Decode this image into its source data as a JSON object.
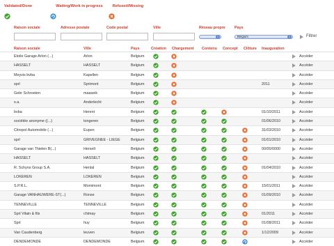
{
  "legend": {
    "done": "Validated/Done",
    "wip": "Waiting/Work in progress",
    "refused": "Refused/Missing"
  },
  "filters": {
    "labels": {
      "raison": "Raison sociale",
      "adresse": "Adresse postale",
      "code": "Code postal",
      "ville": "Ville",
      "reseau": "Réseau propre",
      "pays": "Pays"
    },
    "reseau_value": "",
    "pays_value": "Belgium",
    "filter_button": "Filtrer"
  },
  "table": {
    "headers": {
      "raison": "Raison sociale",
      "ville": "Ville",
      "pays": "Pays",
      "creation": "Création",
      "chargement": "Chargement",
      "contenu": "Contenu",
      "concept": "Concept",
      "cloture": "Clôture",
      "inauguration": "Inauguration"
    },
    "action_label": "Accéder",
    "rows": [
      {
        "raison": "Etoile Garage Arlon (...)",
        "ville": "Arlon",
        "pays": "Belgium",
        "creation": "done",
        "chargement": "refused",
        "contenu": "",
        "concept": "",
        "cloture": "",
        "inauguration": ""
      },
      {
        "raison": "HASSELT",
        "ville": "HASSELT",
        "pays": "Belgium",
        "creation": "done",
        "chargement": "refused",
        "contenu": "",
        "concept": "",
        "cloture": "",
        "inauguration": ""
      },
      {
        "raison": "Meyvis bvba",
        "ville": "Kapellen",
        "pays": "Belgium",
        "creation": "done",
        "chargement": "refused",
        "contenu": "",
        "concept": "",
        "cloture": "",
        "inauguration": ""
      },
      {
        "raison": "sprl",
        "ville": "Sprimont",
        "pays": "Belgium",
        "creation": "done",
        "chargement": "refused",
        "contenu": "",
        "concept": "",
        "cloture": "",
        "inauguration": "2011"
      },
      {
        "raison": "Gebr Schroeten",
        "ville": "maaseik",
        "pays": "Belgium",
        "creation": "done",
        "chargement": "refused",
        "contenu": "",
        "concept": "",
        "cloture": "",
        "inauguration": ""
      },
      {
        "raison": "s.a.",
        "ville": "Anderlecht",
        "pays": "Belgium",
        "creation": "done",
        "chargement": "refused",
        "contenu": "",
        "concept": "",
        "cloture": "",
        "inauguration": ""
      },
      {
        "raison": "bvba",
        "ville": "Herent",
        "pays": "Belgium",
        "creation": "done",
        "chargement": "done",
        "contenu": "done",
        "concept": "refused",
        "cloture": "",
        "inauguration": "01/10/2011"
      },
      {
        "raison": "sociétée anonyme ((...)",
        "ville": "tongeren",
        "pays": "Belgium",
        "creation": "done",
        "chargement": "done",
        "contenu": "done",
        "concept": "done",
        "cloture": "",
        "inauguration": "01/06/2010"
      },
      {
        "raison": "Citropol Automobile (...)",
        "ville": "Eupen",
        "pays": "Belgium",
        "creation": "done",
        "chargement": "done",
        "contenu": "done",
        "concept": "done",
        "cloture": "refused",
        "inauguration": "31/03/2010"
      },
      {
        "raison": "sprl",
        "ville": "GRIVEGNEE - LIEGE",
        "pays": "Belgium",
        "creation": "done",
        "chargement": "done",
        "contenu": "done",
        "concept": "done",
        "cloture": "refused",
        "inauguration": "01/01/2010"
      },
      {
        "raison": "Garage van Thielen B(...)",
        "ville": "Herselt",
        "pays": "Belgium",
        "creation": "done",
        "chargement": "done",
        "contenu": "done",
        "concept": "done",
        "cloture": "refused",
        "inauguration": "00/00/0000"
      },
      {
        "raison": "HASSELT",
        "ville": "HASSELT",
        "pays": "Belgium",
        "creation": "done",
        "chargement": "done",
        "contenu": "done",
        "concept": "done",
        "cloture": "refused",
        "inauguration": ""
      },
      {
        "raison": "R. Schyns Group S.A.",
        "ville": "Henlal",
        "pays": "Belgium",
        "creation": "done",
        "chargement": "done",
        "contenu": "done",
        "concept": "done",
        "cloture": "refused",
        "inauguration": "01/04/2010"
      },
      {
        "raison": "LOKEREN",
        "ville": "LOKEREN",
        "pays": "Belgium",
        "creation": "done",
        "chargement": "done",
        "contenu": "done",
        "concept": "done",
        "cloture": "refused",
        "inauguration": ""
      },
      {
        "raison": "S.P.R.L.",
        "ville": "Momimont",
        "pays": "Belgium",
        "creation": "done",
        "chargement": "done",
        "contenu": "done",
        "concept": "done",
        "cloture": "refused",
        "inauguration": "15/01/2011"
      },
      {
        "raison": "Garage VANHAUWERE-ST(...)",
        "ville": "Ronse",
        "pays": "Belgium",
        "creation": "done",
        "chargement": "done",
        "contenu": "done",
        "concept": "done",
        "cloture": "refused",
        "inauguration": "01/09/2010"
      },
      {
        "raison": "TENNEVILLE",
        "ville": "TENNEVILLE",
        "pays": "Belgium",
        "creation": "done",
        "chargement": "done",
        "contenu": "done",
        "concept": "done",
        "cloture": "refused",
        "inauguration": ""
      },
      {
        "raison": "Sprl Vilain & fils",
        "ville": "chimay",
        "pays": "Belgium",
        "creation": "done",
        "chargement": "done",
        "contenu": "done",
        "concept": "done",
        "cloture": "refused",
        "inauguration": "01/2011"
      },
      {
        "raison": "Sprl",
        "ville": "huy",
        "pays": "Belgium",
        "creation": "done",
        "chargement": "done",
        "contenu": "done",
        "concept": "done",
        "cloture": "refused",
        "inauguration": "01/08/2011"
      },
      {
        "raison": "Van Caudenberg",
        "ville": "leuven",
        "pays": "Belgium",
        "creation": "done",
        "chargement": "done",
        "contenu": "done",
        "concept": "done",
        "cloture": "refused",
        "inauguration": "1/12/2009"
      },
      {
        "raison": "DENDEMONDE",
        "ville": "DENDEMONDE",
        "pays": "Belgium",
        "creation": "done",
        "chargement": "done",
        "contenu": "done",
        "concept": "done",
        "cloture": "wip",
        "inauguration": ""
      }
    ]
  },
  "colors": {
    "accent_red": "#d03a2a",
    "done": "#3fa52a",
    "wip": "#3b8fd8",
    "refused": "#e8692c"
  },
  "icons": {
    "done": "check-circle-icon",
    "wip": "refresh-circle-icon",
    "refused": "x-circle-icon",
    "access": "triangle-right-icon"
  }
}
